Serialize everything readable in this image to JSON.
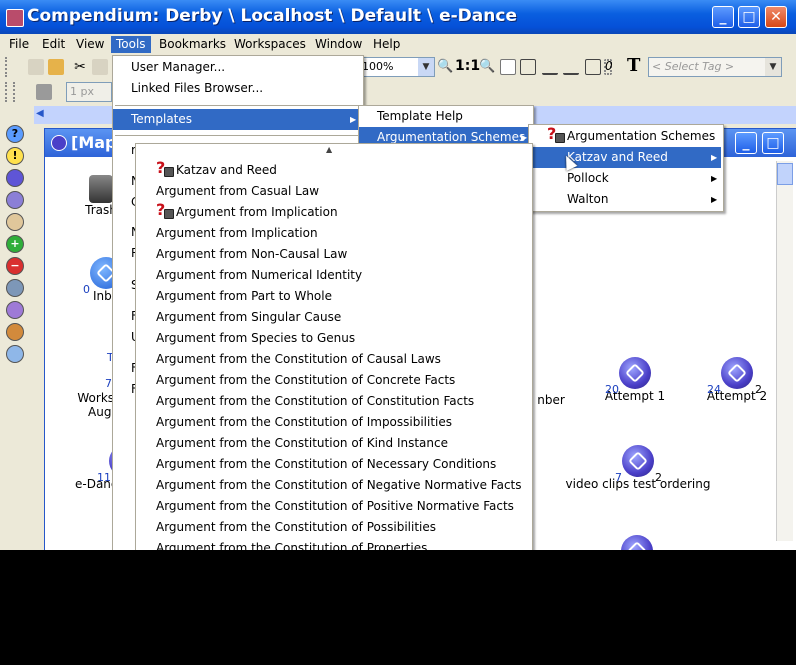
{
  "window": {
    "title": "Compendium: Derby \\ Localhost \\ Default \\ e-Dance",
    "min": "_",
    "max": "□",
    "close": "✕"
  },
  "menubar": [
    "File",
    "Edit",
    "View",
    "Tools",
    "Bookmarks",
    "Workspaces",
    "Window",
    "Help"
  ],
  "toolbar": {
    "zoom": "100%",
    "zoom_11": "1:1",
    "italic_zero": "0",
    "text_tool": "T",
    "tag_placeholder": "< Select Tag >",
    "line_width": "1 px"
  },
  "tools_menu": {
    "items": [
      "User Manager...",
      "Linked Files Browser...",
      "Templates"
    ],
    "obscured": [
      "N",
      "C",
      "N",
      "R",
      "S",
      "F",
      "U",
      "F",
      "F"
    ]
  },
  "templates_menu": [
    "Template Help",
    "Argumentation Schemes"
  ],
  "schemes_menu": [
    "Argumentation Schemes",
    "Katzav and Reed",
    "Pollock",
    "Walton"
  ],
  "katzav_menu": {
    "scroll_up": "▲",
    "items": [
      "Katzav and Reed",
      "Argument from Casual Law",
      "Argument from Implication",
      "Argument from Implication",
      "Argument from Non-Causal Law",
      "Argument from Numerical Identity",
      "Argument from Part to Whole",
      "Argument from Singular Cause",
      "Argument from Species to Genus",
      "Argument from the Constitution of Causal Laws",
      "Argument from the Constitution of Concrete Facts",
      "Argument from the Constitution of Constitution Facts",
      "Argument from the Constitution of Impossibilities",
      "Argument from the Constitution of Kind Instance",
      "Argument from the Constitution of Necessary Conditions",
      "Argument from the Constitution of Negative Normative Facts",
      "Argument from the Constitution of Positive Normative Facts",
      "Argument from the Constitution of Possibilities",
      "Argument from the Constitution of Properties"
    ]
  },
  "map": {
    "title": "[Map",
    "nodes": [
      {
        "label": "Trash",
        "count": ""
      },
      {
        "label": "Inbo",
        "count": "0"
      },
      {
        "label": "Workshop:",
        "sub": "August",
        "count": "7",
        "extra": "T"
      },
      {
        "label": "e-Dance M",
        "count": "11"
      },
      {
        "label": "Attempt 1",
        "count": "20"
      },
      {
        "label": "Attempt 2",
        "count": "24",
        "right": "2"
      },
      {
        "label": "video clips test ordering",
        "count": "7",
        "right": "2"
      },
      {
        "label": "nber",
        "count": ""
      }
    ]
  }
}
